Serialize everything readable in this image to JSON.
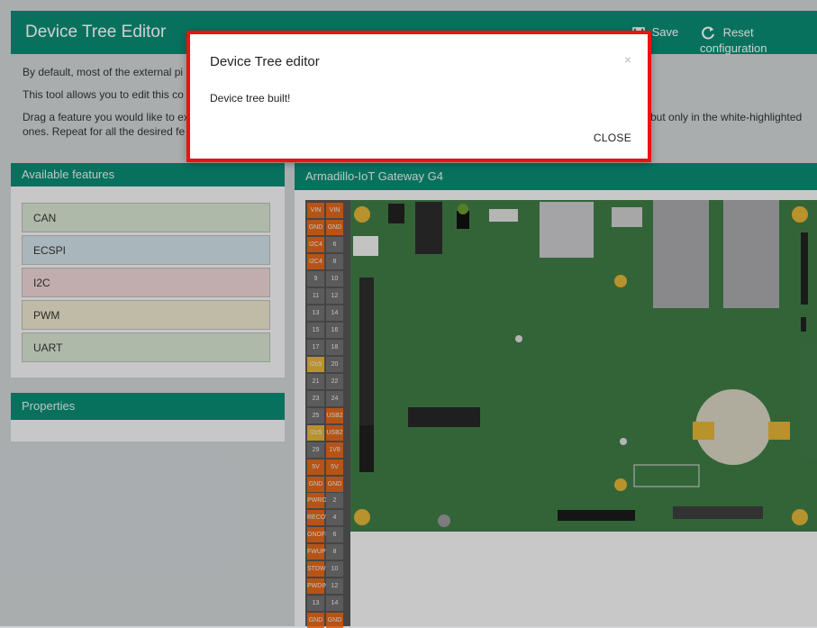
{
  "header": {
    "title": "Device Tree Editor",
    "save_label": "Save",
    "reset_label": "Reset configuration"
  },
  "intro": {
    "line1": "By default, most of the external pi",
    "line2": "This tool allows you to edit this co",
    "line3a": "Drag a feature you would like to ex",
    "line3b": "but only in the white-highlighted",
    "line4": "ones. Repeat for all the desired fe"
  },
  "features_panel": {
    "title": "Available features",
    "items": [
      {
        "label": "CAN",
        "color": "#d5e2cf"
      },
      {
        "label": "ECSPI",
        "color": "#cfdfe6"
      },
      {
        "label": "I2C",
        "color": "#ecd3d3"
      },
      {
        "label": "PWM",
        "color": "#ebe4cc"
      },
      {
        "label": "UART",
        "color": "#d5e2cf"
      }
    ]
  },
  "properties_panel": {
    "title": "Properties"
  },
  "board": {
    "title": "Armadillo-IoT Gateway G4",
    "pins_top": [
      [
        "VIN",
        "VIN"
      ],
      [
        "GND",
        "GND"
      ],
      [
        "I2C4",
        "6"
      ],
      [
        "I2C4",
        "8"
      ],
      [
        "9",
        "10"
      ],
      [
        "11",
        "12"
      ],
      [
        "13",
        "14"
      ],
      [
        "15",
        "16"
      ],
      [
        "17",
        "18"
      ],
      [
        "I2c5",
        "20"
      ],
      [
        "21",
        "22"
      ],
      [
        "23",
        "24"
      ],
      [
        "25",
        "USB2"
      ],
      [
        "I2c5",
        "USB2"
      ],
      [
        "29",
        "1V8"
      ],
      [
        "5V",
        "5V"
      ],
      [
        "GND",
        "GND"
      ]
    ],
    "pins_bottom": [
      [
        "PWRO",
        "2"
      ],
      [
        "RECOV",
        "4"
      ],
      [
        "ONOFF",
        "6"
      ],
      [
        "FWUP",
        "8"
      ],
      [
        "STDWN",
        "10"
      ],
      [
        "PWDIN",
        "12"
      ],
      [
        "13",
        "14"
      ],
      [
        "GND",
        "GND"
      ]
    ]
  },
  "dialog": {
    "title": "Device Tree editor",
    "close_x": "×",
    "message": "Device tree built!",
    "close_label": "CLOSE"
  },
  "colors": {
    "header": "#0a8a72",
    "board_pcb": "#3f7a45",
    "pin_orange": "#e0661a",
    "pin_gray": "#6f6f6f",
    "pin_yellow": "#e2b237",
    "dialog_border": "#ee1111"
  }
}
